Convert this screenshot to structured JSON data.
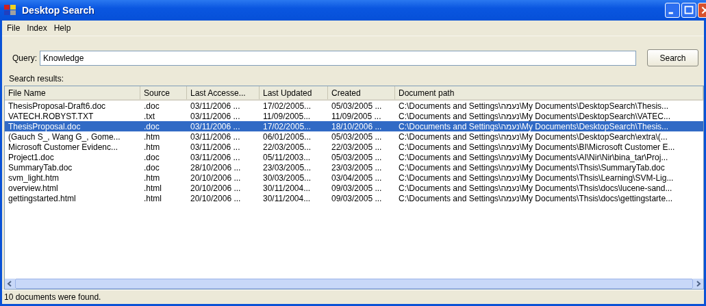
{
  "window": {
    "title": "Desktop Search"
  },
  "menu": [
    "File",
    "Index",
    "Help"
  ],
  "query": {
    "label": "Query:",
    "value": "Knowledge"
  },
  "search_button": "Search",
  "results_label": "Search results:",
  "table": {
    "columns": [
      "File Name",
      "Source",
      "Last Accesse...",
      "Last Updated",
      "Created",
      "Document path"
    ],
    "rows": [
      {
        "selected": false,
        "cells": [
          "ThesisProposal-Draft6.doc",
          ".doc",
          "03/11/2006 ...",
          "17/02/2005...",
          "05/03/2005 ...",
          "C:\\Documents and Settings\\נעמה\\My Documents\\DesktopSearch\\Thesis..."
        ]
      },
      {
        "selected": false,
        "cells": [
          "VATECH.ROBYST.TXT",
          ".txt",
          "03/11/2006 ...",
          "11/09/2005...",
          "11/09/2005 ...",
          "C:\\Documents and Settings\\נעמה\\My Documents\\DesktopSearch\\VATEC..."
        ]
      },
      {
        "selected": true,
        "cells": [
          "ThesisProposal.doc",
          ".doc",
          "03/11/2006 ...",
          "17/02/2005...",
          "18/10/2006 ...",
          "C:\\Documents and Settings\\נעמה\\My Documents\\DesktopSearch\\Thesis..."
        ]
      },
      {
        "selected": false,
        "cells": [
          "(Gauch S_, Wang G_, Gome...",
          ".htm",
          "03/11/2006 ...",
          "06/01/2005...",
          "05/03/2005 ...",
          "C:\\Documents and Settings\\נעמה\\My Documents\\DesktopSearch\\extra\\(..."
        ]
      },
      {
        "selected": false,
        "cells": [
          "Microsoft Customer Evidenc...",
          ".htm",
          "03/11/2006 ...",
          "22/03/2005...",
          "22/03/2005 ...",
          "C:\\Documents and Settings\\נעמה\\My Documents\\BI\\Microsoft Customer E..."
        ]
      },
      {
        "selected": false,
        "cells": [
          "Project1.doc",
          ".doc",
          "03/11/2006 ...",
          "05/11/2003...",
          "05/03/2005 ...",
          "C:\\Documents and Settings\\נעמה\\My Documents\\AI\\Nir\\Nir\\bina_tar\\Proj..."
        ]
      },
      {
        "selected": false,
        "cells": [
          "SummaryTab.doc",
          ".doc",
          "28/10/2006 ...",
          "23/03/2005...",
          "23/03/2005 ...",
          "C:\\Documents and Settings\\נעמה\\My Documents\\Thsis\\SummaryTab.doc"
        ]
      },
      {
        "selected": false,
        "cells": [
          "svm_light.htm",
          ".htm",
          "20/10/2006 ...",
          "30/03/2005...",
          "03/04/2005 ...",
          "C:\\Documents and Settings\\נעמה\\My Documents\\Thsis\\Learning\\SVM-Lig..."
        ]
      },
      {
        "selected": false,
        "cells": [
          "overview.html",
          ".html",
          "20/10/2006 ...",
          "30/11/2004...",
          "09/03/2005 ...",
          "C:\\Documents and Settings\\נעמה\\My Documents\\Thsis\\docs\\lucene-sand..."
        ]
      },
      {
        "selected": false,
        "cells": [
          "gettingstarted.html",
          ".html",
          "20/10/2006 ...",
          "30/11/2004...",
          "09/03/2005 ...",
          "C:\\Documents and Settings\\נעמה\\My Documents\\Thsis\\docs\\gettingstarte..."
        ]
      }
    ]
  },
  "status_bar": "10 documents were found."
}
